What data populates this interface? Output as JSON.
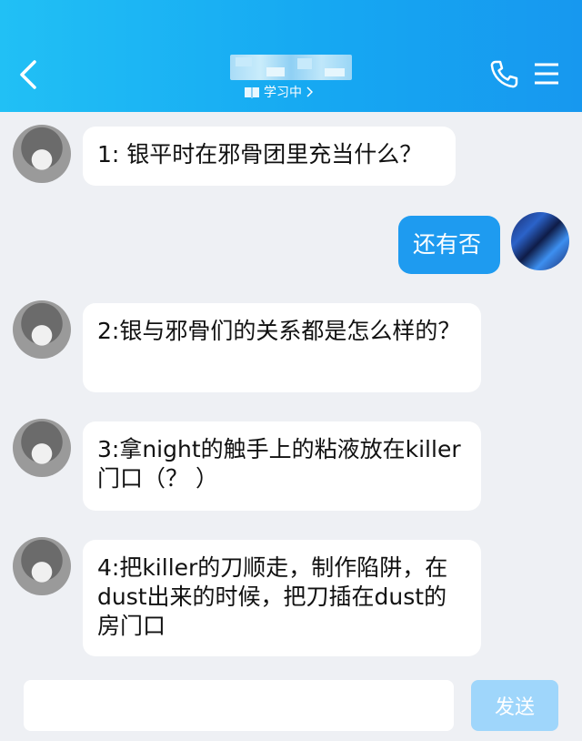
{
  "header": {
    "status_text": "学习中",
    "colors": {
      "start": "#21c0f5",
      "end": "#1798ef"
    },
    "icons": {
      "back": "chevron-left-icon",
      "status": "book-icon",
      "call": "phone-icon",
      "menu": "menu-icon"
    }
  },
  "messages": [
    {
      "sender": "other",
      "text": "1: 银平时在邪骨团里充当什么？"
    },
    {
      "sender": "self",
      "text": "还有否"
    },
    {
      "sender": "other",
      "text": "2:银与邪骨们的关系都是怎么样的？"
    },
    {
      "sender": "other",
      "text": "3:拿night的触手上的粘液放在killer门口（？ ）"
    },
    {
      "sender": "other",
      "text": "4:把killer的刀顺走，制作陷阱，在dust出来的时候，把刀插在dust的房门口"
    }
  ],
  "input": {
    "value": "",
    "placeholder": ""
  },
  "send_label": "发送",
  "colors": {
    "self_bubble": "#1e9bf0",
    "send_button": "#9fd6fb",
    "background": "#eef0f4"
  }
}
